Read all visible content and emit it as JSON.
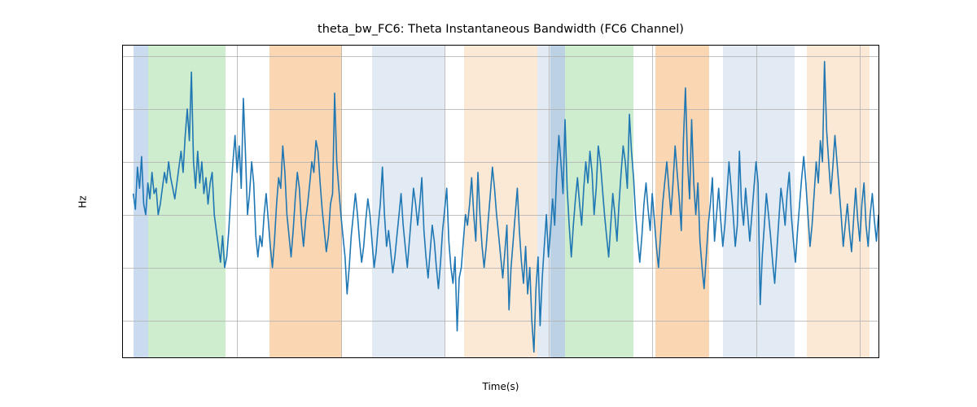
{
  "chart_data": {
    "type": "line",
    "title": "theta_bw_FC6: Theta Instantaneous Bandwidth (FC6 Channel)",
    "xlabel": "Time(s)",
    "ylabel": "Hz",
    "xlim": [
      -100,
      7180
    ],
    "ylim": [
      1.23,
      1.82
    ],
    "xticks": [
      1000,
      2000,
      3000,
      4000,
      5000,
      6000,
      7000
    ],
    "yticks": [
      1.3,
      1.4,
      1.5,
      1.6,
      1.7,
      1.8
    ],
    "grid": true,
    "bands": [
      {
        "x0": 0,
        "x1": 140,
        "color": "#aec7e8",
        "alpha": 0.65
      },
      {
        "x0": 140,
        "x1": 890,
        "color": "#b4e2b4",
        "alpha": 0.65
      },
      {
        "x0": 1310,
        "x1": 2010,
        "color": "#f9c088",
        "alpha": 0.65
      },
      {
        "x0": 2300,
        "x1": 3000,
        "color": "#d6e3ef",
        "alpha": 0.7
      },
      {
        "x0": 3190,
        "x1": 3890,
        "color": "#fbe0c3",
        "alpha": 0.7
      },
      {
        "x0": 3890,
        "x1": 4020,
        "color": "#d6e3ef",
        "alpha": 0.7
      },
      {
        "x0": 4020,
        "x1": 4160,
        "color": "#9fbfd9",
        "alpha": 0.7
      },
      {
        "x0": 4160,
        "x1": 4820,
        "color": "#b4e2b4",
        "alpha": 0.65
      },
      {
        "x0": 5030,
        "x1": 5550,
        "color": "#f9c088",
        "alpha": 0.65
      },
      {
        "x0": 5680,
        "x1": 6370,
        "color": "#d6e3ef",
        "alpha": 0.7
      },
      {
        "x0": 6490,
        "x1": 7090,
        "color": "#fbe0c3",
        "alpha": 0.7
      }
    ],
    "series": [
      {
        "name": "theta_bw_FC6",
        "color": "#1f77b4",
        "x_step": 20,
        "values": [
          1.54,
          1.51,
          1.59,
          1.55,
          1.61,
          1.52,
          1.5,
          1.56,
          1.53,
          1.58,
          1.54,
          1.55,
          1.5,
          1.52,
          1.55,
          1.58,
          1.56,
          1.6,
          1.57,
          1.55,
          1.53,
          1.56,
          1.59,
          1.62,
          1.58,
          1.65,
          1.7,
          1.64,
          1.77,
          1.6,
          1.55,
          1.62,
          1.56,
          1.6,
          1.54,
          1.57,
          1.52,
          1.56,
          1.58,
          1.5,
          1.47,
          1.44,
          1.41,
          1.46,
          1.4,
          1.42,
          1.47,
          1.54,
          1.6,
          1.65,
          1.58,
          1.63,
          1.55,
          1.72,
          1.62,
          1.5,
          1.54,
          1.6,
          1.56,
          1.46,
          1.42,
          1.46,
          1.44,
          1.5,
          1.54,
          1.49,
          1.44,
          1.4,
          1.45,
          1.52,
          1.57,
          1.55,
          1.63,
          1.58,
          1.5,
          1.46,
          1.42,
          1.47,
          1.53,
          1.58,
          1.55,
          1.48,
          1.44,
          1.49,
          1.52,
          1.56,
          1.6,
          1.58,
          1.64,
          1.62,
          1.56,
          1.51,
          1.47,
          1.43,
          1.46,
          1.52,
          1.54,
          1.73,
          1.6,
          1.55,
          1.5,
          1.46,
          1.42,
          1.35,
          1.4,
          1.46,
          1.5,
          1.54,
          1.5,
          1.45,
          1.41,
          1.44,
          1.49,
          1.53,
          1.5,
          1.45,
          1.4,
          1.43,
          1.48,
          1.52,
          1.59,
          1.5,
          1.44,
          1.47,
          1.43,
          1.39,
          1.42,
          1.46,
          1.5,
          1.54,
          1.48,
          1.44,
          1.4,
          1.45,
          1.5,
          1.55,
          1.52,
          1.48,
          1.52,
          1.57,
          1.47,
          1.42,
          1.38,
          1.43,
          1.48,
          1.45,
          1.4,
          1.36,
          1.41,
          1.47,
          1.51,
          1.55,
          1.45,
          1.4,
          1.37,
          1.42,
          1.28,
          1.38,
          1.4,
          1.45,
          1.5,
          1.48,
          1.52,
          1.57,
          1.5,
          1.45,
          1.58,
          1.5,
          1.44,
          1.4,
          1.44,
          1.49,
          1.54,
          1.59,
          1.55,
          1.5,
          1.46,
          1.42,
          1.38,
          1.43,
          1.48,
          1.32,
          1.4,
          1.45,
          1.5,
          1.55,
          1.47,
          1.41,
          1.37,
          1.44,
          1.35,
          1.4,
          1.3,
          1.24,
          1.36,
          1.42,
          1.29,
          1.38,
          1.44,
          1.5,
          1.42,
          1.47,
          1.53,
          1.48,
          1.58,
          1.65,
          1.6,
          1.54,
          1.68,
          1.55,
          1.48,
          1.42,
          1.48,
          1.53,
          1.57,
          1.52,
          1.48,
          1.55,
          1.6,
          1.56,
          1.62,
          1.58,
          1.5,
          1.55,
          1.63,
          1.6,
          1.55,
          1.5,
          1.46,
          1.42,
          1.48,
          1.54,
          1.5,
          1.45,
          1.52,
          1.58,
          1.63,
          1.6,
          1.55,
          1.69,
          1.62,
          1.57,
          1.5,
          1.45,
          1.41,
          1.46,
          1.52,
          1.56,
          1.51,
          1.47,
          1.54,
          1.49,
          1.44,
          1.4,
          1.46,
          1.52,
          1.56,
          1.6,
          1.55,
          1.5,
          1.56,
          1.63,
          1.58,
          1.53,
          1.47,
          1.64,
          1.74,
          1.6,
          1.53,
          1.68,
          1.56,
          1.5,
          1.56,
          1.45,
          1.4,
          1.36,
          1.42,
          1.48,
          1.52,
          1.57,
          1.45,
          1.5,
          1.55,
          1.49,
          1.44,
          1.48,
          1.54,
          1.6,
          1.55,
          1.5,
          1.44,
          1.48,
          1.62,
          1.52,
          1.48,
          1.55,
          1.5,
          1.45,
          1.5,
          1.55,
          1.6,
          1.56,
          1.33,
          1.42,
          1.48,
          1.54,
          1.5,
          1.46,
          1.41,
          1.37,
          1.43,
          1.49,
          1.55,
          1.52,
          1.48,
          1.54,
          1.58,
          1.5,
          1.45,
          1.41,
          1.47,
          1.52,
          1.57,
          1.61,
          1.56,
          1.5,
          1.44,
          1.48,
          1.54,
          1.6,
          1.56,
          1.64,
          1.6,
          1.79,
          1.66,
          1.6,
          1.54,
          1.59,
          1.65,
          1.6,
          1.55,
          1.5,
          1.44,
          1.48,
          1.52,
          1.47,
          1.43,
          1.49,
          1.55,
          1.49,
          1.45,
          1.52,
          1.56,
          1.48,
          1.44,
          1.5,
          1.54,
          1.49,
          1.45,
          1.5
        ]
      }
    ]
  }
}
